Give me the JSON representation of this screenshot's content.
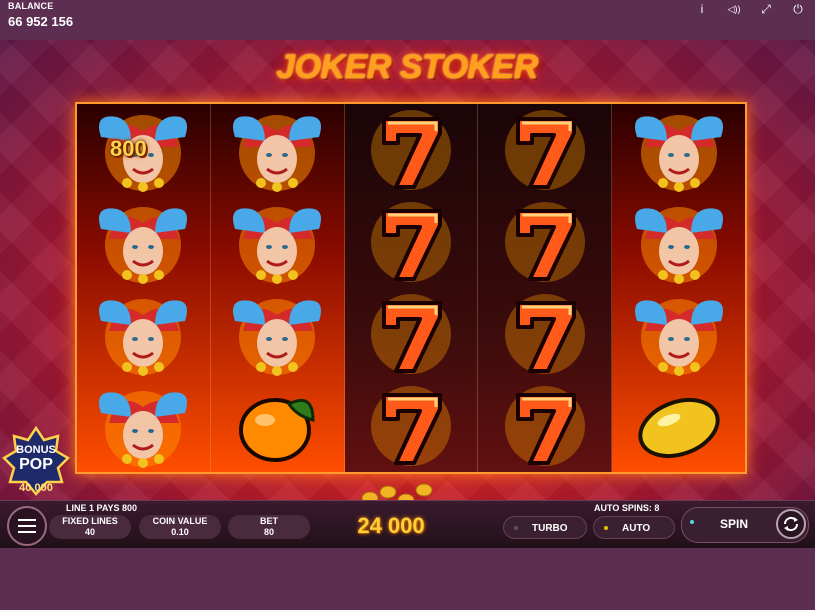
{
  "header": {
    "balance_label": "BALANCE",
    "balance_value": "66 952 156",
    "icons": [
      "info-icon",
      "sound-icon",
      "fullscreen-icon",
      "power-icon"
    ],
    "info_glyph": "i",
    "sound_glyph": "◁))",
    "fullscreen_glyph": "⤢",
    "power_glyph": "⏻"
  },
  "game": {
    "logo": "JOKER STOKER",
    "win_amount": "800",
    "reels": [
      [
        "joker",
        "joker",
        "joker",
        "joker"
      ],
      [
        "joker",
        "joker",
        "joker",
        "orange"
      ],
      [
        "seven",
        "seven",
        "seven",
        "seven"
      ],
      [
        "seven",
        "seven",
        "seven",
        "seven"
      ],
      [
        "joker",
        "joker",
        "joker",
        "lemon"
      ]
    ],
    "bonus": {
      "line1": "BONUS",
      "line2": "POP",
      "value": "40 000"
    },
    "colors": {
      "accent": "#ff9a2e",
      "gold": "#ffcf3a",
      "spin_dot": "#4ed6e8"
    }
  },
  "bottom_bar": {
    "line_info": "LINE 1 PAYS 800",
    "auto_spins": "AUTO SPINS: 8",
    "fixed_lines_label": "FIXED LINES",
    "fixed_lines_value": "40",
    "coin_value_label": "COIN VALUE",
    "coin_value": "0.10",
    "bet_label": "BET",
    "bet_value": "80",
    "total_win": "24 000",
    "turbo_label": "TURBO",
    "auto_label": "AUTO",
    "spin_label": "SPIN"
  }
}
